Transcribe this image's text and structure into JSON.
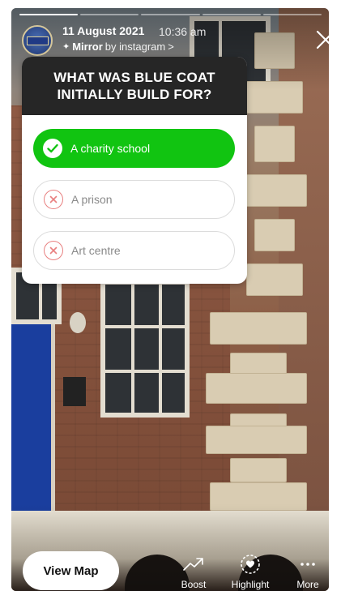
{
  "story": {
    "progress_segments": 5,
    "progress_filled": 1,
    "date": "11 August 2021",
    "time": "10:36 am",
    "source_name": "Mirror",
    "source_by": "by instagram",
    "source_chevron": ">"
  },
  "quiz": {
    "question": "WHAT WAS BLUE COAT INITIALLY BUILD FOR?",
    "options": [
      {
        "label": "A charity school",
        "state": "correct"
      },
      {
        "label": "A prison",
        "state": "wrong"
      },
      {
        "label": "Art centre",
        "state": "wrong"
      }
    ],
    "correct_color": "#11c411",
    "wrong_color": "#e88080"
  },
  "bottom": {
    "view_map": "View Map",
    "boost": "Boost",
    "highlight": "Highlight",
    "more": "More"
  },
  "icons": {
    "close": "close-icon",
    "sparkle": "sparkle-icon",
    "check": "check-icon",
    "cross": "cross-icon",
    "boost": "trending-up-icon",
    "highlight": "heart-circle-icon",
    "more": "more-dots-icon"
  }
}
